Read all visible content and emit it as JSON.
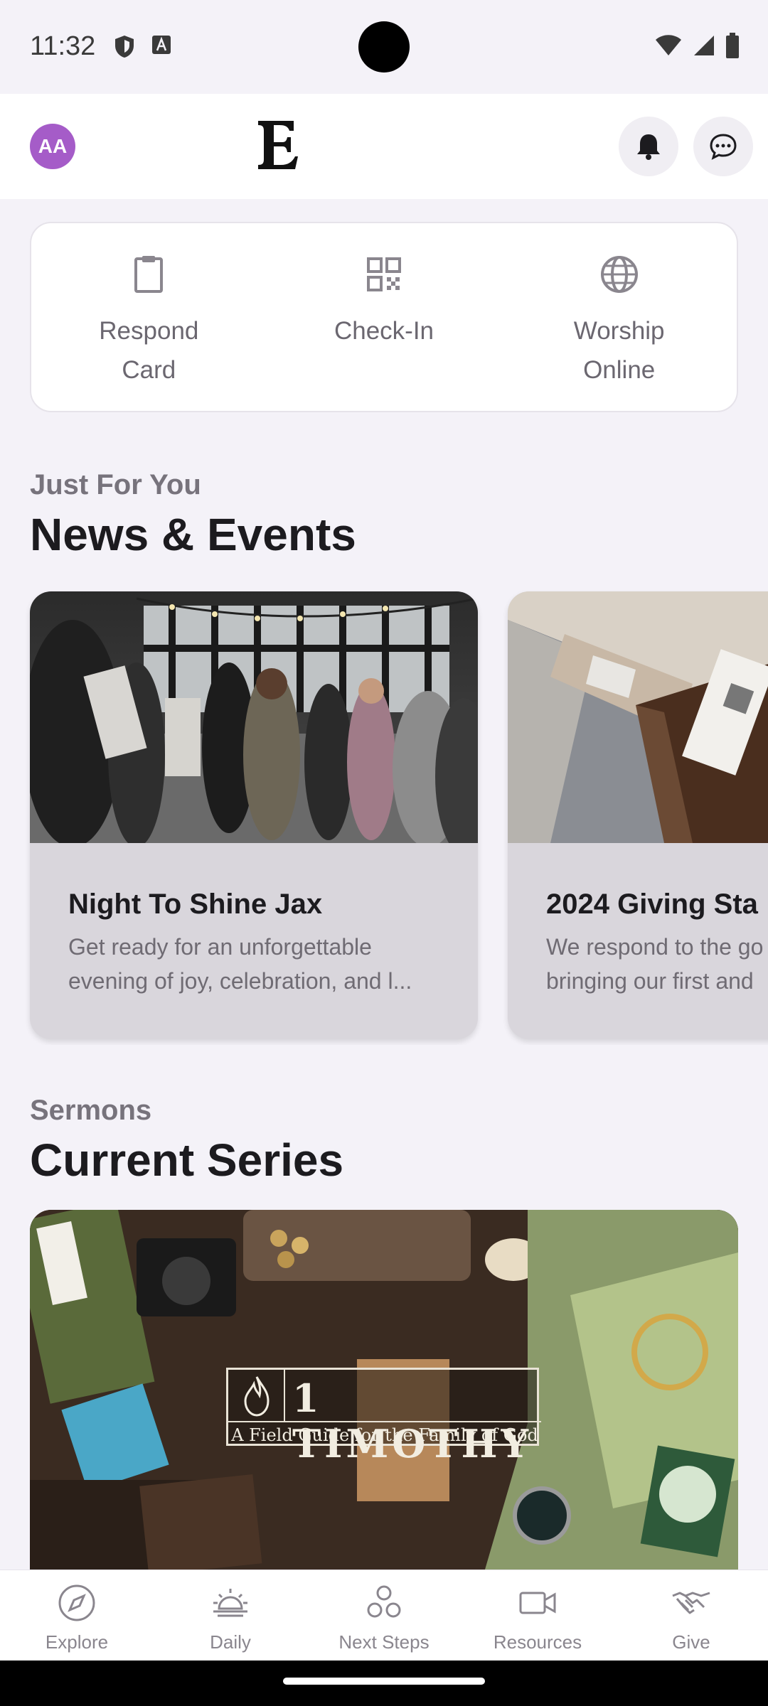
{
  "status_bar": {
    "time": "11:32",
    "icons": [
      "shield-icon",
      "font-icon",
      "wifi-icon",
      "signal-icon",
      "battery-icon"
    ]
  },
  "header": {
    "avatar_initials": "AA",
    "logo_alt": "E",
    "icons": [
      "bell-icon",
      "chat-icon"
    ]
  },
  "quick_actions": [
    {
      "label": "Respond Card",
      "icon": "clipboard-icon"
    },
    {
      "label": "Check-In",
      "icon": "qr-code-icon"
    },
    {
      "label": "Worship Online",
      "icon": "globe-icon"
    }
  ],
  "news_section": {
    "kicker": "Just For You",
    "title": "News & Events",
    "cards": [
      {
        "title": "Night To Shine Jax",
        "desc_line1": "Get ready for an unforgettable",
        "desc_line2": "evening of joy, celebration, and l..."
      },
      {
        "title": "2024 Giving Sta",
        "desc_line1": "We respond to the go",
        "desc_line2": "bringing our first and"
      }
    ]
  },
  "sermons_section": {
    "kicker": "Sermons",
    "title": "Current Series",
    "banner_title": "1 TIMOTHY",
    "banner_subtitle": "A Field Guide for the Family of God"
  },
  "bottom_nav": [
    {
      "label": "Explore",
      "icon": "compass-icon"
    },
    {
      "label": "Daily",
      "icon": "sunrise-icon"
    },
    {
      "label": "Next Steps",
      "icon": "circles-icon"
    },
    {
      "label": "Resources",
      "icon": "video-icon"
    },
    {
      "label": "Give",
      "icon": "handshake-icon"
    }
  ],
  "colors": {
    "background": "#f4f2f8",
    "avatar": "#a55cc8",
    "muted_text": "#6b6770"
  }
}
